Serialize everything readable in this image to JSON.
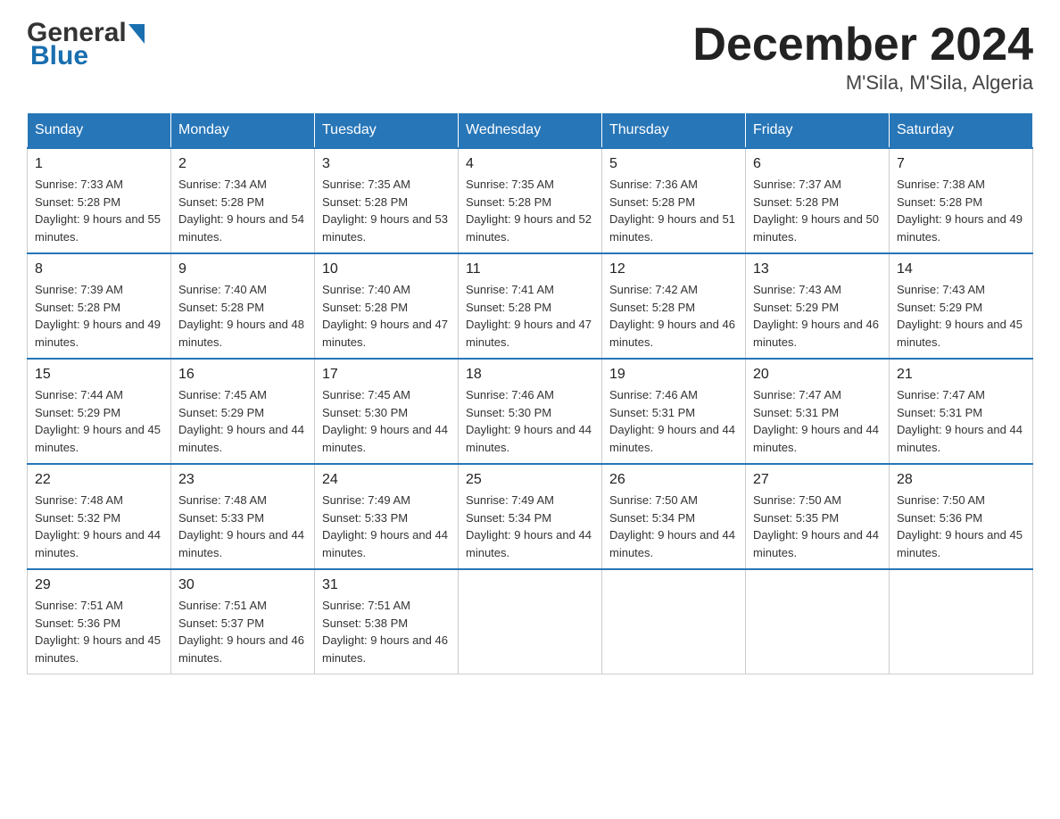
{
  "header": {
    "logo_part1": "General",
    "logo_part2": "Blue",
    "month_year": "December 2024",
    "location": "M'Sila, M'Sila, Algeria"
  },
  "days_of_week": [
    "Sunday",
    "Monday",
    "Tuesday",
    "Wednesday",
    "Thursday",
    "Friday",
    "Saturday"
  ],
  "weeks": [
    [
      {
        "num": "1",
        "sunrise": "7:33 AM",
        "sunset": "5:28 PM",
        "daylight": "9 hours and 55 minutes."
      },
      {
        "num": "2",
        "sunrise": "7:34 AM",
        "sunset": "5:28 PM",
        "daylight": "9 hours and 54 minutes."
      },
      {
        "num": "3",
        "sunrise": "7:35 AM",
        "sunset": "5:28 PM",
        "daylight": "9 hours and 53 minutes."
      },
      {
        "num": "4",
        "sunrise": "7:35 AM",
        "sunset": "5:28 PM",
        "daylight": "9 hours and 52 minutes."
      },
      {
        "num": "5",
        "sunrise": "7:36 AM",
        "sunset": "5:28 PM",
        "daylight": "9 hours and 51 minutes."
      },
      {
        "num": "6",
        "sunrise": "7:37 AM",
        "sunset": "5:28 PM",
        "daylight": "9 hours and 50 minutes."
      },
      {
        "num": "7",
        "sunrise": "7:38 AM",
        "sunset": "5:28 PM",
        "daylight": "9 hours and 49 minutes."
      }
    ],
    [
      {
        "num": "8",
        "sunrise": "7:39 AM",
        "sunset": "5:28 PM",
        "daylight": "9 hours and 49 minutes."
      },
      {
        "num": "9",
        "sunrise": "7:40 AM",
        "sunset": "5:28 PM",
        "daylight": "9 hours and 48 minutes."
      },
      {
        "num": "10",
        "sunrise": "7:40 AM",
        "sunset": "5:28 PM",
        "daylight": "9 hours and 47 minutes."
      },
      {
        "num": "11",
        "sunrise": "7:41 AM",
        "sunset": "5:28 PM",
        "daylight": "9 hours and 47 minutes."
      },
      {
        "num": "12",
        "sunrise": "7:42 AM",
        "sunset": "5:28 PM",
        "daylight": "9 hours and 46 minutes."
      },
      {
        "num": "13",
        "sunrise": "7:43 AM",
        "sunset": "5:29 PM",
        "daylight": "9 hours and 46 minutes."
      },
      {
        "num": "14",
        "sunrise": "7:43 AM",
        "sunset": "5:29 PM",
        "daylight": "9 hours and 45 minutes."
      }
    ],
    [
      {
        "num": "15",
        "sunrise": "7:44 AM",
        "sunset": "5:29 PM",
        "daylight": "9 hours and 45 minutes."
      },
      {
        "num": "16",
        "sunrise": "7:45 AM",
        "sunset": "5:29 PM",
        "daylight": "9 hours and 44 minutes."
      },
      {
        "num": "17",
        "sunrise": "7:45 AM",
        "sunset": "5:30 PM",
        "daylight": "9 hours and 44 minutes."
      },
      {
        "num": "18",
        "sunrise": "7:46 AM",
        "sunset": "5:30 PM",
        "daylight": "9 hours and 44 minutes."
      },
      {
        "num": "19",
        "sunrise": "7:46 AM",
        "sunset": "5:31 PM",
        "daylight": "9 hours and 44 minutes."
      },
      {
        "num": "20",
        "sunrise": "7:47 AM",
        "sunset": "5:31 PM",
        "daylight": "9 hours and 44 minutes."
      },
      {
        "num": "21",
        "sunrise": "7:47 AM",
        "sunset": "5:31 PM",
        "daylight": "9 hours and 44 minutes."
      }
    ],
    [
      {
        "num": "22",
        "sunrise": "7:48 AM",
        "sunset": "5:32 PM",
        "daylight": "9 hours and 44 minutes."
      },
      {
        "num": "23",
        "sunrise": "7:48 AM",
        "sunset": "5:33 PM",
        "daylight": "9 hours and 44 minutes."
      },
      {
        "num": "24",
        "sunrise": "7:49 AM",
        "sunset": "5:33 PM",
        "daylight": "9 hours and 44 minutes."
      },
      {
        "num": "25",
        "sunrise": "7:49 AM",
        "sunset": "5:34 PM",
        "daylight": "9 hours and 44 minutes."
      },
      {
        "num": "26",
        "sunrise": "7:50 AM",
        "sunset": "5:34 PM",
        "daylight": "9 hours and 44 minutes."
      },
      {
        "num": "27",
        "sunrise": "7:50 AM",
        "sunset": "5:35 PM",
        "daylight": "9 hours and 44 minutes."
      },
      {
        "num": "28",
        "sunrise": "7:50 AM",
        "sunset": "5:36 PM",
        "daylight": "9 hours and 45 minutes."
      }
    ],
    [
      {
        "num": "29",
        "sunrise": "7:51 AM",
        "sunset": "5:36 PM",
        "daylight": "9 hours and 45 minutes."
      },
      {
        "num": "30",
        "sunrise": "7:51 AM",
        "sunset": "5:37 PM",
        "daylight": "9 hours and 46 minutes."
      },
      {
        "num": "31",
        "sunrise": "7:51 AM",
        "sunset": "5:38 PM",
        "daylight": "9 hours and 46 minutes."
      },
      null,
      null,
      null,
      null
    ]
  ]
}
